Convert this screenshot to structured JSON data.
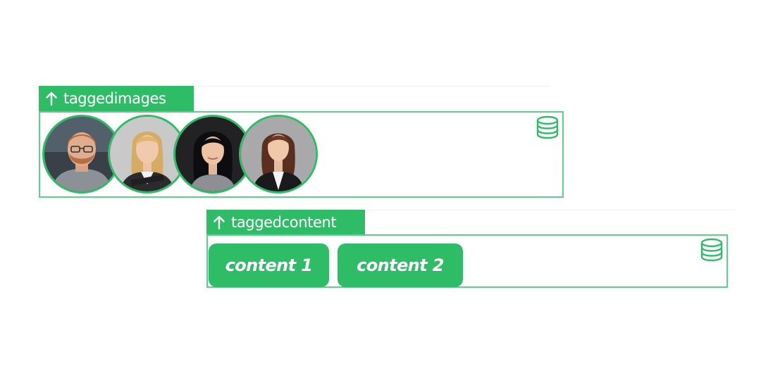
{
  "theme": {
    "accent": "#2ebd66",
    "border": "#5bd08a",
    "background": "#ffffff"
  },
  "tagged_images": {
    "label": "taggedimages",
    "label_icon": "arrow-up-icon",
    "source_icon": "database-icon",
    "avatars": [
      {
        "name": "avatar-man-glasses",
        "description_icon": "portrait"
      },
      {
        "name": "avatar-woman-blonde",
        "description_icon": "portrait"
      },
      {
        "name": "avatar-woman-dark-hair",
        "description_icon": "portrait"
      },
      {
        "name": "avatar-woman-brown-hair",
        "description_icon": "portrait"
      }
    ]
  },
  "tagged_content": {
    "label": "taggedcontent",
    "label_icon": "arrow-up-icon",
    "source_icon": "database-icon",
    "items": [
      {
        "label": "content 1"
      },
      {
        "label": "content 2"
      }
    ]
  }
}
